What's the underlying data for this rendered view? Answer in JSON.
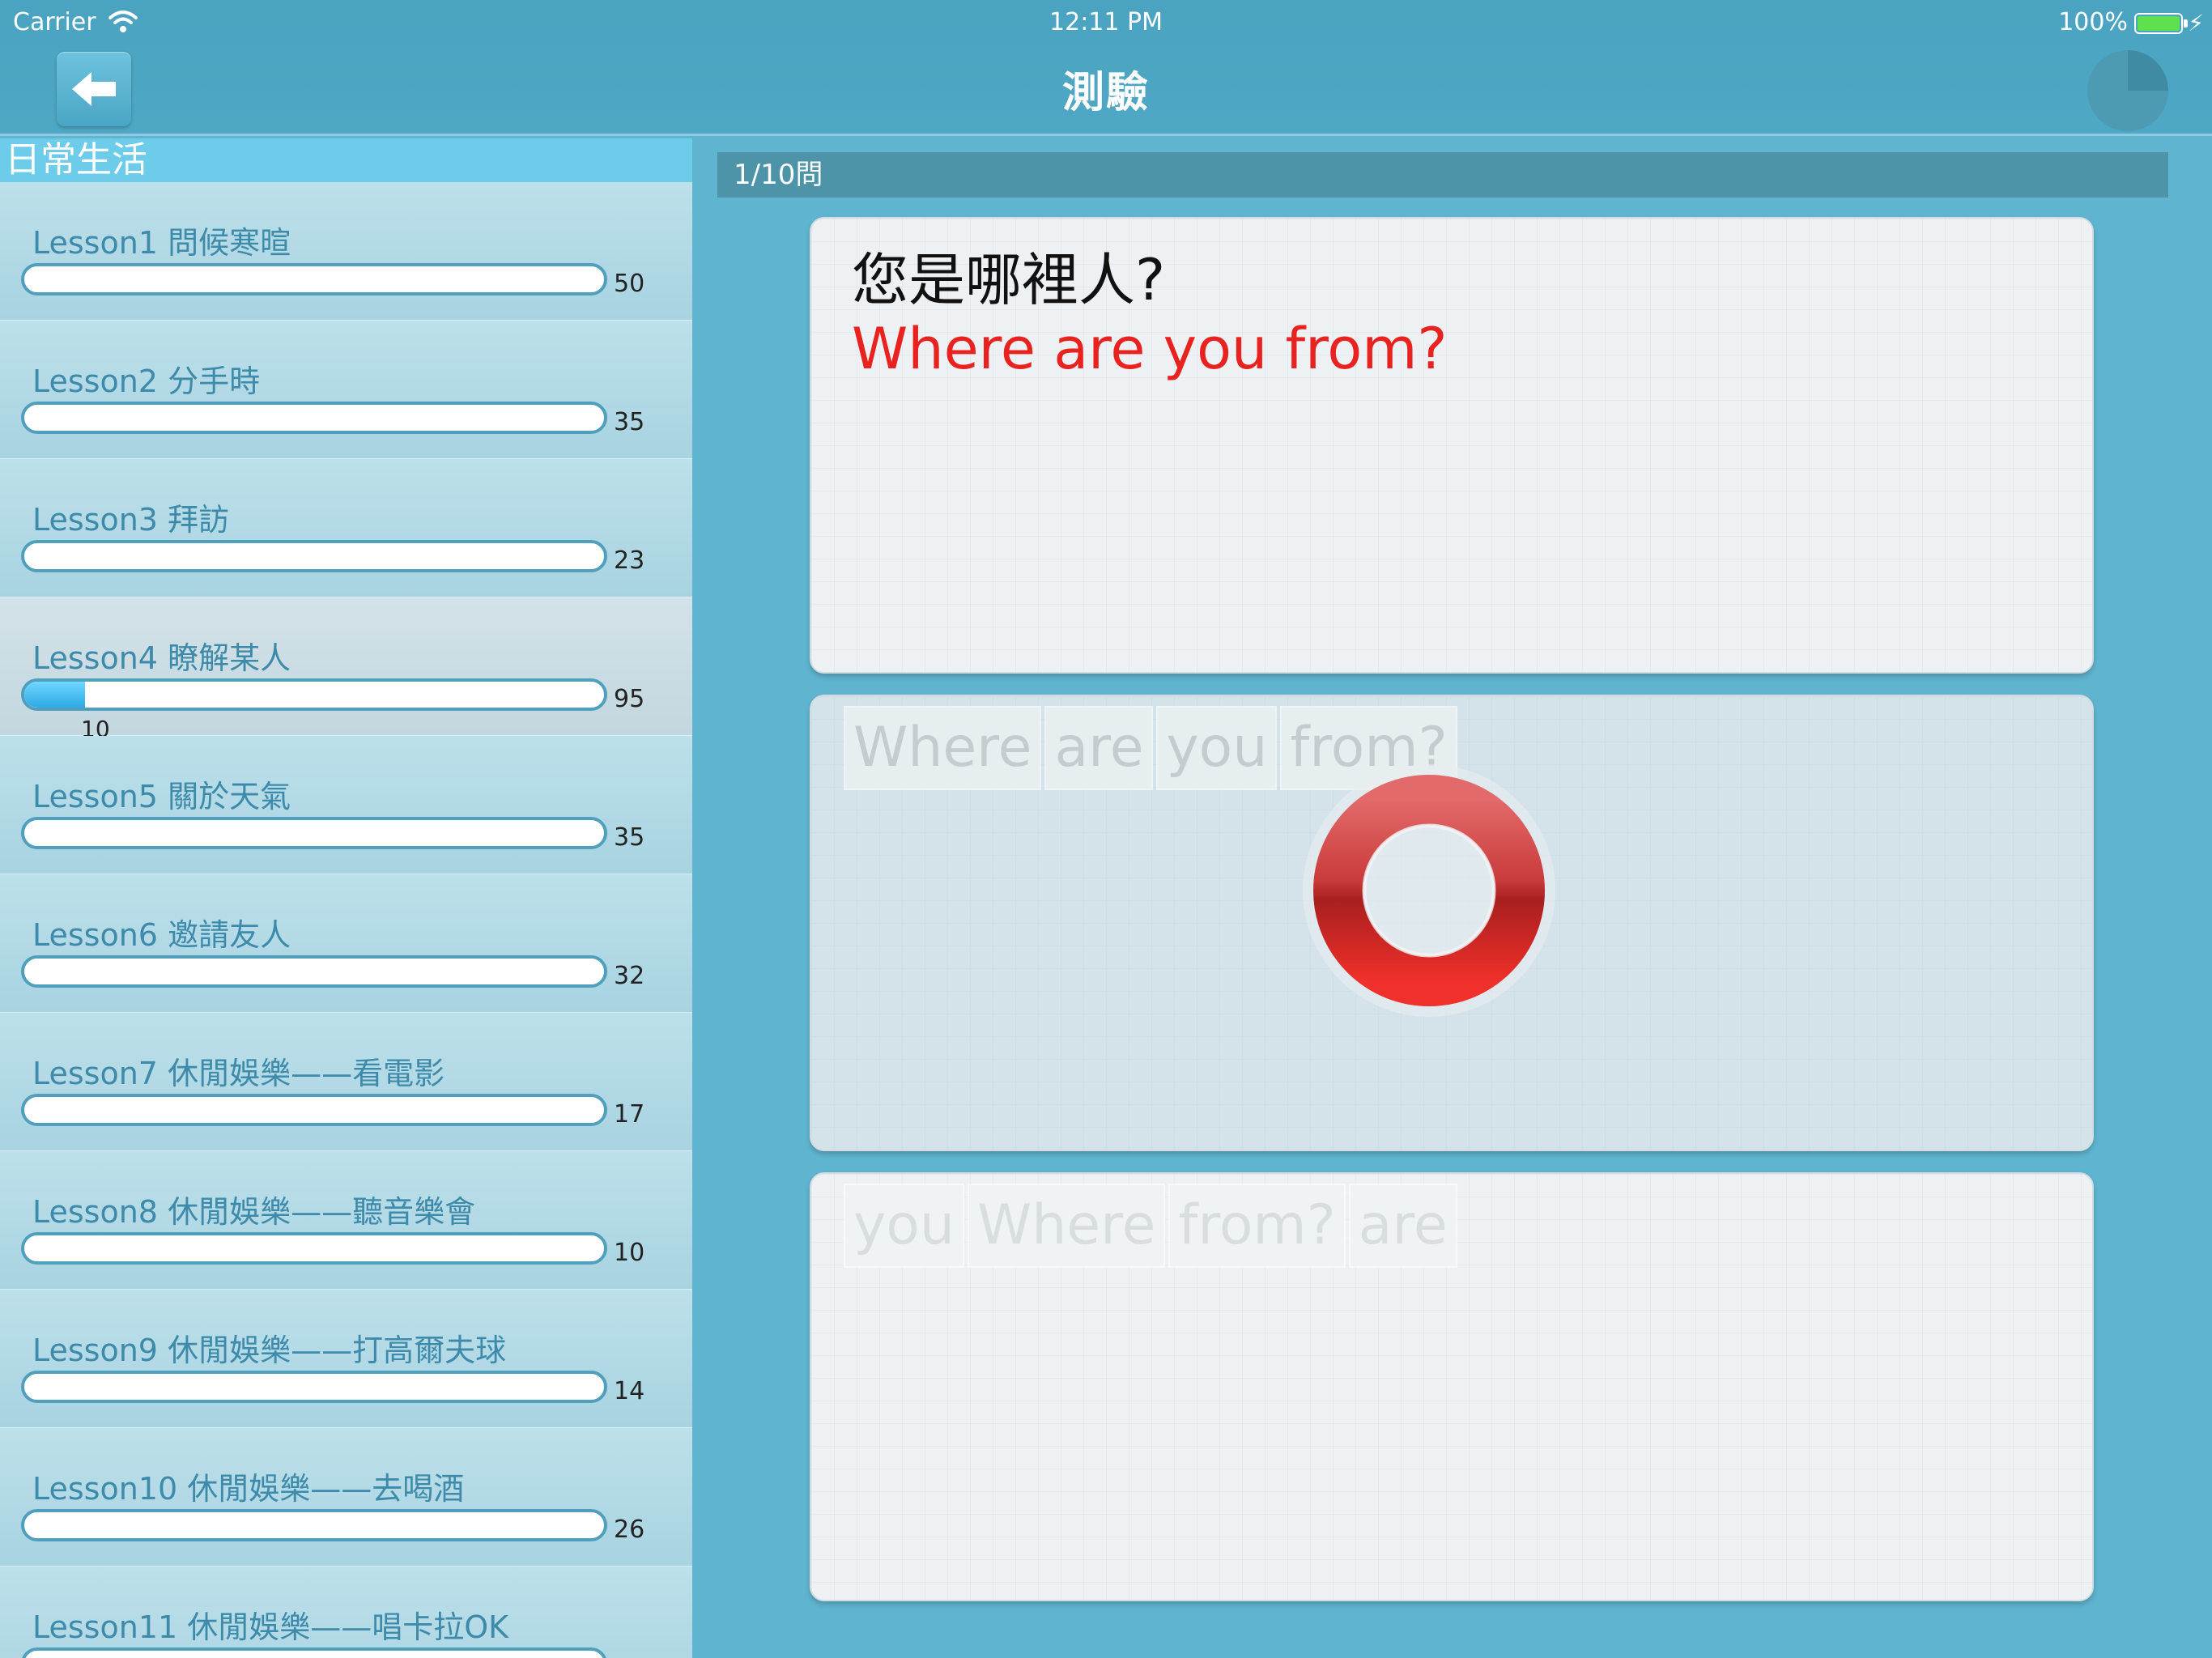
{
  "status_bar": {
    "carrier": "Carrier",
    "time": "12:11 PM",
    "battery": "100%"
  },
  "header": {
    "title": "測驗",
    "back_icon": "arrow-left-icon",
    "timer_icon": "pie-timer-icon"
  },
  "sidebar": {
    "section_title": "日常生活",
    "lessons": [
      {
        "title": "Lesson1 問候寒暄",
        "total": "50",
        "done": "",
        "progress": 0
      },
      {
        "title": "Lesson2 分手時",
        "total": "35",
        "done": "",
        "progress": 0
      },
      {
        "title": "Lesson3 拜訪",
        "total": "23",
        "done": "",
        "progress": 0
      },
      {
        "title": "Lesson4 瞭解某人",
        "total": "95",
        "done": "10",
        "progress": 0.105
      },
      {
        "title": "Lesson5 關於天氣",
        "total": "35",
        "done": "",
        "progress": 0
      },
      {
        "title": "Lesson6 邀請友人",
        "total": "32",
        "done": "",
        "progress": 0
      },
      {
        "title": "Lesson7 休閒娛樂——看電影",
        "total": "17",
        "done": "",
        "progress": 0
      },
      {
        "title": "Lesson8 休閒娛樂——聽音樂會",
        "total": "10",
        "done": "",
        "progress": 0
      },
      {
        "title": "Lesson9 休閒娛樂——打高爾夫球",
        "total": "14",
        "done": "",
        "progress": 0
      },
      {
        "title": "Lesson10 休閒娛樂——去喝酒",
        "total": "26",
        "done": "",
        "progress": 0
      },
      {
        "title": "Lesson11 休閒娛樂——唱卡拉OK",
        "total": "",
        "done": "",
        "progress": 0
      }
    ]
  },
  "quiz": {
    "counter": "1/10問",
    "question_chinese": "您是哪裡人?",
    "question_english": "Where are you from?",
    "answer_words": [
      "Where",
      "are",
      "you",
      "from?"
    ],
    "choice_words": [
      "you",
      "Where",
      "from?",
      "are"
    ],
    "result": "correct",
    "result_icon": "correct-circle-icon"
  },
  "colors": {
    "accent": "#4ea8c5",
    "correct_ring": "#e02a2a",
    "english_text": "#e8221f"
  }
}
